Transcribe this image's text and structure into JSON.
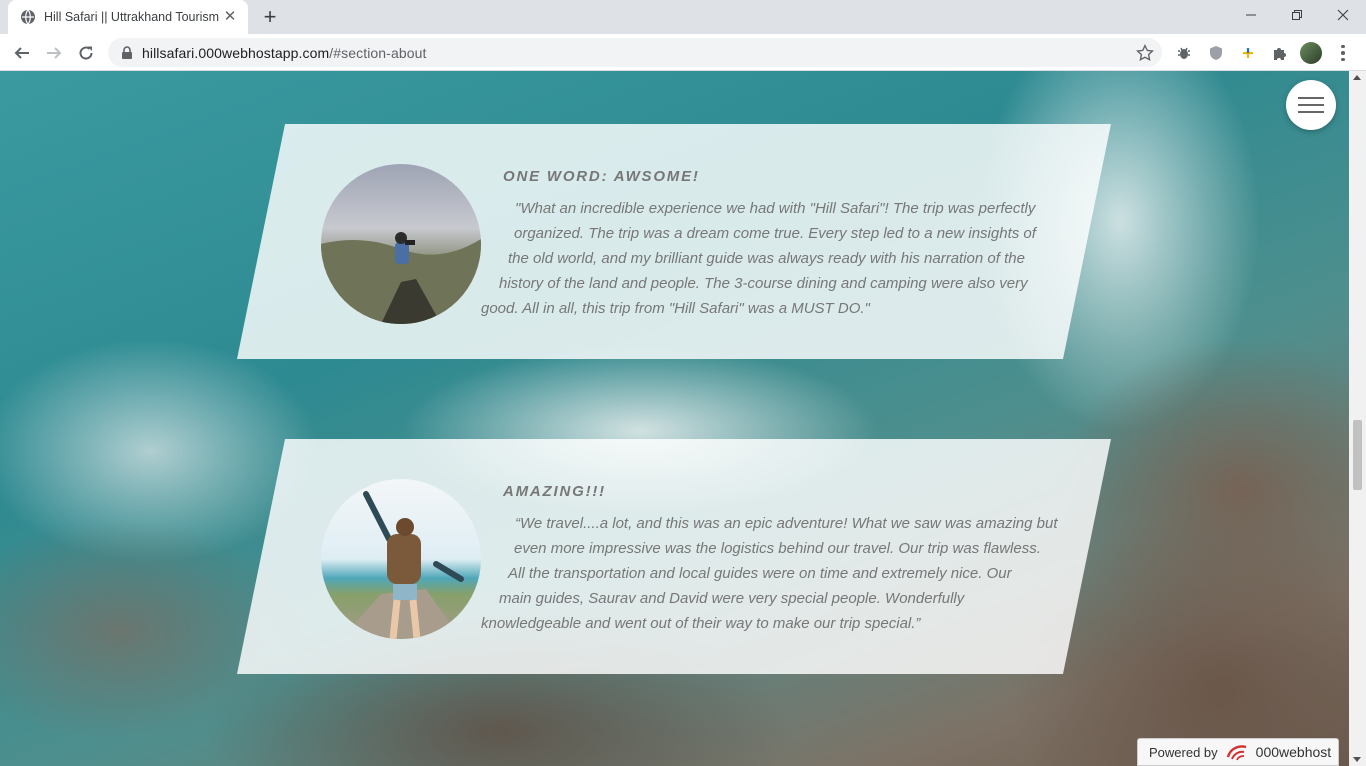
{
  "browser": {
    "tab_title": "Hill Safari || Uttrakhand Tourism",
    "url_domain": "hillsafari.000webhostapp.com",
    "url_path": "/#section-about",
    "icons": [
      "globe-icon",
      "close-icon",
      "plus-icon",
      "minimize-icon",
      "maximize-icon",
      "close-window-icon",
      "back-arrow-icon",
      "forward-arrow-icon",
      "reload-icon",
      "lock-icon",
      "star-icon",
      "bug-extension-icon",
      "shield-extension-icon",
      "plus-extension-icon",
      "puzzle-extension-icon",
      "avatar",
      "more-vert-icon"
    ]
  },
  "testimonials": [
    {
      "heading": "ONE WORD: AWSOME!",
      "lines": [
        "\"What an incredible experience we had with \"Hill Safari\"! The trip was perfectly",
        "organized. The trip was a dream come true. Every step led to a new insights of",
        "the old world, and my brilliant guide was always ready with his narration of the",
        "history of the land and people. The 3-course dining and camping were also very",
        "good. All in all, this trip from \"Hill Safari\" was a MUST DO.\""
      ]
    },
    {
      "heading": "AMAZING!!!",
      "lines": [
        "“We travel....a lot, and this was an epic adventure! What we saw was amazing but",
        "even more impressive was the logistics behind our travel. Our trip was flawless.",
        "All the transportation and local guides were on time and extremely nice. Our",
        "main guides, Saurav and David were very special people. Wonderfully",
        "knowledgeable and went out of their way to make our trip special.”"
      ]
    }
  ],
  "powered_by": {
    "label": "Powered by",
    "brand": "000webhost"
  },
  "colors": {
    "card_text": "#777777",
    "brand_red": "#d62e2e"
  }
}
